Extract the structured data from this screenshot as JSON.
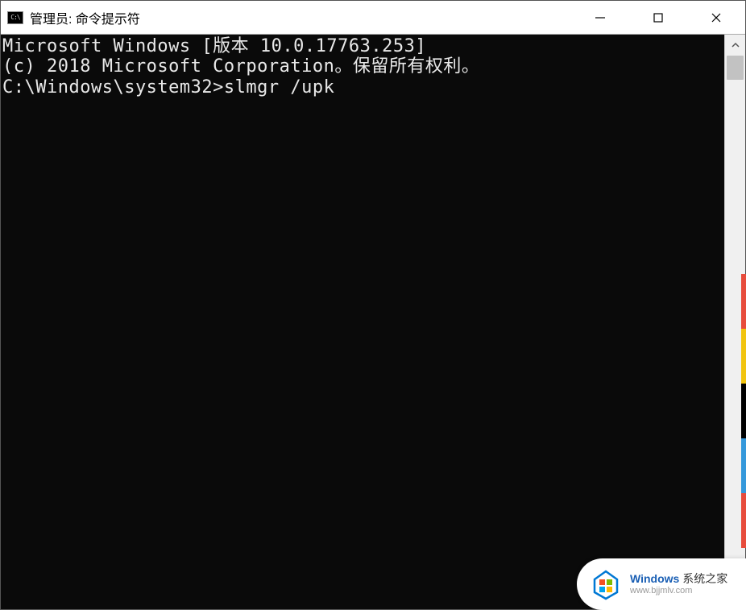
{
  "window": {
    "title": "管理员: 命令提示符",
    "icon_label": "C:\\"
  },
  "terminal": {
    "lines": [
      "Microsoft Windows [版本 10.0.17763.253]",
      "(c) 2018 Microsoft Corporation。保留所有权利。",
      "",
      "C:\\Windows\\system32>slmgr /upk"
    ]
  },
  "watermark": {
    "brand_prefix": "Windows",
    "brand_suffix": " 系统之家",
    "url": "www.bjjmlv.com"
  }
}
